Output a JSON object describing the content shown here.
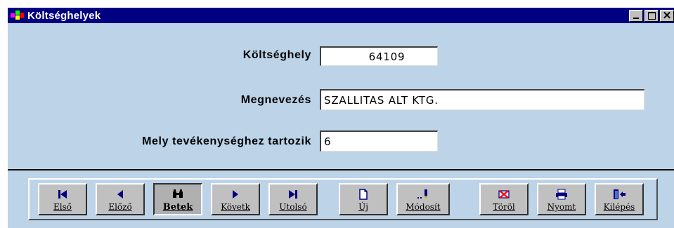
{
  "window": {
    "title": "Költséghelyek",
    "controls": {
      "minimize": "_",
      "maximize": "□",
      "close": "✕"
    }
  },
  "form": {
    "cost_center": {
      "label": "Költséghely",
      "value": "64109"
    },
    "name": {
      "label": "Megnevezés",
      "value": "SZALLITAS ALT KTG."
    },
    "activity": {
      "label": "Mely tevékenységhez tartozik",
      "value": "6"
    }
  },
  "toolbar": {
    "buttons": [
      {
        "label": "Első",
        "icon": "first-record-icon"
      },
      {
        "label": "Előző",
        "icon": "previous-record-icon"
      },
      {
        "label": "Betek",
        "icon": "binoculars-icon"
      },
      {
        "label": "Követk",
        "icon": "next-record-icon"
      },
      {
        "label": "Utolsó",
        "icon": "last-record-icon"
      },
      {
        "label": "Új",
        "icon": "new-document-icon"
      },
      {
        "label": "Módosít",
        "icon": "edit-pencil-icon"
      },
      {
        "label": "Töröl",
        "icon": "delete-icon"
      },
      {
        "label": "Nyomt",
        "icon": "printer-icon"
      },
      {
        "label": "Kilépés",
        "icon": "exit-door-icon"
      }
    ]
  },
  "colors": {
    "window_bg": "#bcd3e8",
    "titlebar": "#000080",
    "icon_navy": "#000080"
  }
}
